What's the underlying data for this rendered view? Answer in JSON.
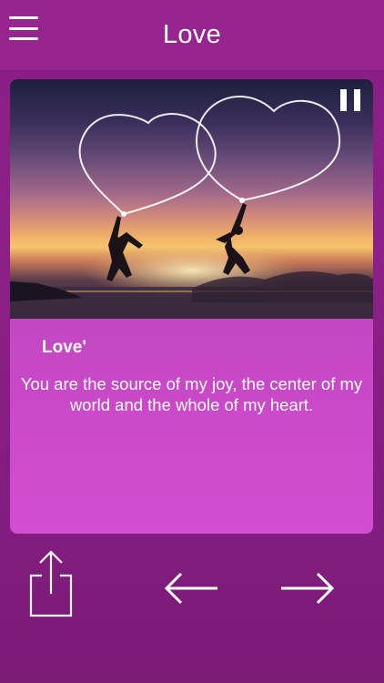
{
  "header": {
    "title": "Love",
    "menu_icon": "hamburger-menu-icon"
  },
  "card": {
    "image_description_icon": "couple-hearts-photo",
    "pause_icon": "pause-icon",
    "quote_title": "Love'",
    "quote_text": "You are the source of my joy, the center of my world and the whole of my heart."
  },
  "toolbar": {
    "share_icon": "share-icon",
    "previous_icon": "arrow-left-icon",
    "next_icon": "arrow-right-icon"
  },
  "colors": {
    "header_bg": "#96258f",
    "page_bg": "#8a1e86",
    "card_bg": "#c548c4",
    "text": "#ffffff"
  }
}
